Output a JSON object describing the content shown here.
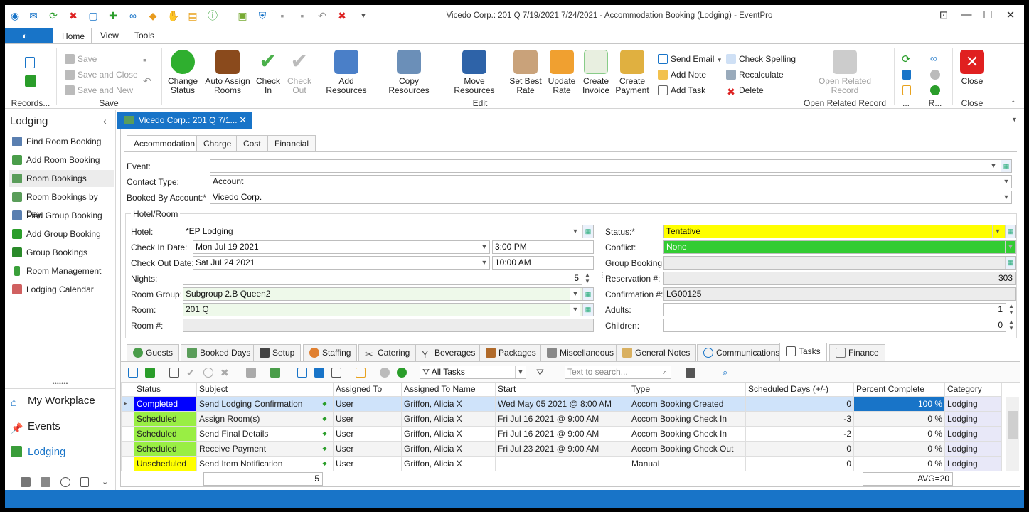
{
  "window": {
    "title": "Vicedo Corp.: 201 Q 7/19/2021 7/24/2021  - Accommodation Booking (Lodging) - EventPro"
  },
  "ribbon_tabs": [
    "Home",
    "View",
    "Tools"
  ],
  "ribbon": {
    "records": {
      "group": "Records..."
    },
    "save": {
      "save": "Save",
      "save_close": "Save and Close",
      "save_new": "Save and New",
      "group": "Save"
    },
    "edit": {
      "change_status": "Change\nStatus",
      "auto_assign": "Auto Assign\nRooms",
      "check_in": "Check\nIn",
      "check_out": "Check\nOut",
      "add_resources": "Add Resources",
      "copy_resources": "Copy Resources",
      "move_resources": "Move Resources",
      "set_best_rate": "Set Best\nRate",
      "update_rate": "Update\nRate",
      "create_invoice": "Create\nInvoice",
      "create_payment": "Create\nPayment",
      "send_email": "Send Email",
      "add_note": "Add Note",
      "add_task": "Add Task",
      "check_spelling": "Check Spelling",
      "recalculate": "Recalculate",
      "delete": "Delete",
      "group": "Edit"
    },
    "open_related": {
      "button": "Open Related\nRecord",
      "group": "Open Related Record"
    },
    "misc": {
      "group1": "...",
      "group2": "R..."
    },
    "close": {
      "button": "Close",
      "group": "Close"
    }
  },
  "sidebar": {
    "title": "Lodging",
    "items": [
      "Find Room Booking",
      "Add Room Booking",
      "Room Bookings",
      "Room Bookings by Day",
      "Find Group Booking",
      "Add Group Booking",
      "Group Bookings",
      "Room Management",
      "Lodging Calendar"
    ],
    "nav": [
      "My Workplace",
      "Events",
      "Lodging"
    ]
  },
  "doc_tab": "Vicedo Corp.: 201 Q 7/1...",
  "form_tabs": [
    "Accommodation",
    "Charge",
    "Cost",
    "Financial"
  ],
  "form": {
    "event_label": "Event:",
    "event": "",
    "contact_type_label": "Contact Type:",
    "contact_type": "Account",
    "booked_by_label": "Booked By Account:*",
    "booked_by": "Vicedo Corp.",
    "hotel_room_label": "Hotel/Room",
    "hotel_label": "Hotel:",
    "hotel": "*EP Lodging",
    "checkin_label": "Check In Date:",
    "checkin_date": "Mon Jul 19 2021",
    "checkin_time": "3:00 PM",
    "checkout_label": "Check Out Date:",
    "checkout_date": "Sat Jul 24 2021",
    "checkout_time": "10:00 AM",
    "nights_label": "Nights:",
    "nights": "5",
    "room_group_label": "Room Group:",
    "room_group": "Subgroup 2.B Queen2",
    "room_label": "Room:",
    "room": "201 Q",
    "room_num_label": "Room #:",
    "room_num": "",
    "status_label": "Status:*",
    "status": "Tentative",
    "conflict_label": "Conflict:",
    "conflict": "None",
    "group_booking_label": "Group Booking:",
    "group_booking": "",
    "reservation_label": "Reservation #:",
    "reservation": "303",
    "confirmation_label": "Confirmation #:",
    "confirmation": "LG00125",
    "adults_label": "Adults:",
    "adults": "1",
    "children_label": "Children:",
    "children": "0"
  },
  "bottom_tabs": [
    "Guests",
    "Booked Days",
    "Setup",
    "Staffing",
    "Catering",
    "Beverages",
    "Packages",
    "Miscellaneous",
    "General Notes",
    "Communications",
    "Tasks",
    "Finance"
  ],
  "grid_toolbar": {
    "filter": "All Tasks",
    "search_placeholder": "Text to search..."
  },
  "grid": {
    "columns": [
      "Status",
      "Subject",
      "",
      "Assigned To",
      "Assigned To Name",
      "Start",
      "Type",
      "Scheduled Days (+/-)",
      "Percent Complete",
      "Category"
    ],
    "rows": [
      {
        "status": "Completed",
        "subject": "Send Lodging Confirmation",
        "assigned_to": "User",
        "name": "Griffon, Alicia X",
        "start": "Wed May 05 2021 @ 8:00 AM",
        "type": "Accom Booking Created",
        "days": "0",
        "pct": "100 %",
        "category": "Lodging"
      },
      {
        "status": "Scheduled",
        "subject": "Assign Room(s)",
        "assigned_to": "User",
        "name": "Griffon, Alicia X",
        "start": "Fri Jul 16 2021 @ 9:00 AM",
        "type": "Accom Booking Check In",
        "days": "-3",
        "pct": "0 %",
        "category": "Lodging"
      },
      {
        "status": "Scheduled",
        "subject": "Send Final Details",
        "assigned_to": "User",
        "name": "Griffon, Alicia X",
        "start": "Fri Jul 16 2021 @ 9:00 AM",
        "type": "Accom Booking Check In",
        "days": "-2",
        "pct": "0 %",
        "category": "Lodging"
      },
      {
        "status": "Scheduled",
        "subject": "Receive Payment",
        "assigned_to": "User",
        "name": "Griffon, Alicia X",
        "start": "Fri Jul 23 2021 @ 9:00 AM",
        "type": "Accom Booking Check Out",
        "days": "0",
        "pct": "0 %",
        "category": "Lodging"
      },
      {
        "status": "Unscheduled",
        "subject": "Send Item Notification",
        "assigned_to": "User",
        "name": "Griffon, Alicia X",
        "start": "",
        "type": "Manual",
        "days": "0",
        "pct": "0 %",
        "category": "Lodging"
      }
    ],
    "footer_count": "5",
    "footer_avg": "AVG=20"
  },
  "colors": {
    "accent": "#1874c8",
    "completed": "#0000ff",
    "scheduled": "#99ee44",
    "unscheduled": "#ffff00",
    "tentative": "#ffff00",
    "conflict_none": "#33cc33"
  }
}
